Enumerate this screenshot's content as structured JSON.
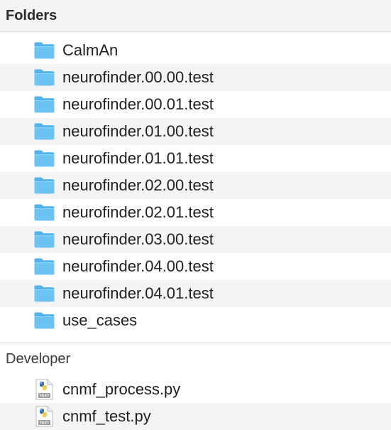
{
  "sections": {
    "folders": {
      "title": "Folders",
      "items": [
        {
          "label": "CalmAn",
          "icon": "folder-icon"
        },
        {
          "label": "neurofinder.00.00.test",
          "icon": "folder-icon"
        },
        {
          "label": "neurofinder.00.01.test",
          "icon": "folder-icon"
        },
        {
          "label": "neurofinder.01.00.test",
          "icon": "folder-icon"
        },
        {
          "label": "neurofinder.01.01.test",
          "icon": "folder-icon"
        },
        {
          "label": "neurofinder.02.00.test",
          "icon": "folder-icon"
        },
        {
          "label": "neurofinder.02.01.test",
          "icon": "folder-icon"
        },
        {
          "label": "neurofinder.03.00.test",
          "icon": "folder-icon"
        },
        {
          "label": "neurofinder.04.00.test",
          "icon": "folder-icon"
        },
        {
          "label": "neurofinder.04.01.test",
          "icon": "folder-icon"
        },
        {
          "label": "use_cases",
          "icon": "folder-icon"
        }
      ]
    },
    "developer": {
      "title": "Developer",
      "items": [
        {
          "label": "cnmf_process.py",
          "icon": "python-file-icon",
          "badge": "TEXT"
        },
        {
          "label": "cnmf_test.py",
          "icon": "python-file-icon",
          "badge": "TEXT"
        }
      ]
    }
  },
  "colors": {
    "folder_body": "#6cc3f2",
    "folder_tab": "#4fb2eb",
    "row_alt": "#f4f4f4",
    "header_bg": "#f3f3f3"
  }
}
